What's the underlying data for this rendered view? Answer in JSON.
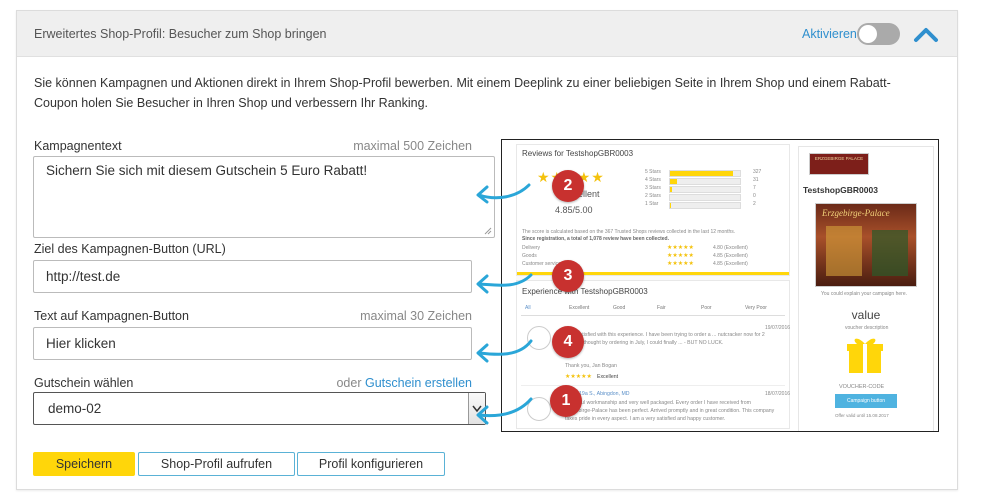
{
  "panel": {
    "title": "Erweitertes Shop-Profil: Besucher zum Shop bringen",
    "activate_label": "Aktivieren",
    "toggle_on": false
  },
  "intro": "Sie können Kampagnen und Aktionen direkt in Ihrem Shop-Profil bewerben. Mit einem Deeplink zu einer beliebigen Seite in Ihrem Shop und einem Rabatt-Coupon holen Sie Besucher in Ihren Shop und verbessern Ihr Ranking.",
  "fields": {
    "campaign_text": {
      "label": "Kampagnentext",
      "hint": "maximal 500 Zeichen",
      "value": "Sichern Sie sich mit diesem Gutschein 5 Euro Rabatt!"
    },
    "button_url": {
      "label": "Ziel des Kampagnen-Button (URL)",
      "value": "http://test.de"
    },
    "button_text": {
      "label": "Text auf Kampagnen-Button",
      "hint": "maximal 30 Zeichen",
      "value": "Hier klicken"
    },
    "voucher": {
      "label": "Gutschein wählen",
      "hint_prefix": "oder",
      "hint_link": "Gutschein erstellen",
      "value": "demo-02"
    }
  },
  "buttons": {
    "save": "Speichern",
    "open_profile": "Shop-Profil aufrufen",
    "configure_profile": "Profil konfigurieren"
  },
  "preview": {
    "reviews_title": "Reviews for TestshopGBR0003",
    "rating_word": "Excellent",
    "rating_value": "4.85/5.00",
    "star_rows": [
      {
        "label": "5 Stars",
        "count": "327",
        "fill": 0.9
      },
      {
        "label": "4 Stars",
        "count": "31",
        "fill": 0.1
      },
      {
        "label": "3 Stars",
        "count": "7",
        "fill": 0.03
      },
      {
        "label": "2 Stars",
        "count": "0",
        "fill": 0
      },
      {
        "label": "1 Star",
        "count": "2",
        "fill": 0.01
      }
    ],
    "score_note": "The score is calculated based on the 367 Trusted Shops reviews collected in the last 12 months.",
    "score_note2": "Since registration, a total of 1,078 review have been collected.",
    "criteria": [
      {
        "label": "Delivery",
        "score": "4.80 (Excellent)"
      },
      {
        "label": "Goods",
        "score": "4.85 (Excellent)"
      },
      {
        "label": "Customer service",
        "score": "4.85 (Excellent)"
      }
    ],
    "experience_title": "Experience with TestshopGBR0003",
    "filter_tabs": [
      "All",
      "Excellent",
      "Good",
      "Fair",
      "Poor",
      "Very Poor"
    ],
    "review1_date": "19/07/2016",
    "review1_text": "Very satisfied with this experience. I have been trying to order a ... nutcracker now for 2 years. I thought by ordering in July, I could finally ... - BUT NO LUCK.",
    "review1_sign": "Thank you, Jan Bogan",
    "review1_rating": "Excellent",
    "review2_author": "M-19a S., Abingdon, MD",
    "review2_date": "18/07/2016",
    "review2_text": "Beautiful workmanship and very well packaged. Every order I have received from Erzgebirge-Palace has been perfect. Arrived promptly and in great condition. This company takes pride in every aspect. I am a very satisfied and happy customer.",
    "shop_name": "TestshopGBR0003",
    "logo_text": "ERZGEBIRGE PALACE",
    "banner_text": "Erzgebirge-Palace",
    "explain_text": "You could explain your campaign here.",
    "value_title": "value",
    "voucher_desc": "voucher description",
    "voucher_code_label": "VOUCHER-CODE",
    "campaign_button": "Campaign button",
    "offer_valid": "Offer valid until 15.08.2017",
    "badges": [
      "1",
      "2",
      "3",
      "4"
    ],
    "accent": "#c8312f",
    "arrow_color": "#2aa6d8"
  }
}
